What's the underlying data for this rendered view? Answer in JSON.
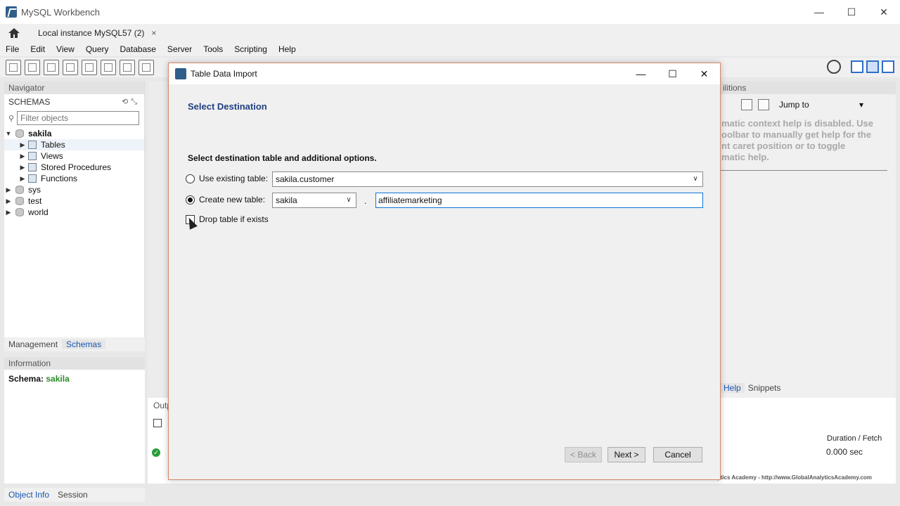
{
  "app": {
    "title": "MySQL Workbench",
    "window_controls": {
      "minimize": "—",
      "maximize": "☐",
      "close": "✕"
    }
  },
  "connection_tab": {
    "label": "Local instance MySQL57 (2)",
    "close": "×"
  },
  "menu": [
    "File",
    "Edit",
    "View",
    "Query",
    "Database",
    "Server",
    "Tools",
    "Scripting",
    "Help"
  ],
  "navigator": {
    "header": "Navigator",
    "schemas_label": "SCHEMAS",
    "filter_placeholder": "Filter objects",
    "tree": [
      {
        "label": "sakila",
        "expanded": true,
        "bold": true
      },
      {
        "label": "Tables"
      },
      {
        "label": "Views"
      },
      {
        "label": "Stored Procedures"
      },
      {
        "label": "Functions"
      },
      {
        "label": "sys"
      },
      {
        "label": "test"
      },
      {
        "label": "world"
      }
    ],
    "tabs": [
      "Management",
      "Schemas"
    ]
  },
  "information": {
    "header": "Information",
    "schema_label": "Schema:",
    "schema_value": "sakila"
  },
  "bottom_tabs": [
    "Object Info",
    "Session"
  ],
  "output": {
    "label": "Outp",
    "duration_header": "Duration / Fetch",
    "duration_value": "0.000 sec"
  },
  "right_panel": {
    "header": "ilitions",
    "jump_to": "Jump to",
    "help_lines": [
      "matic context help is disabled. Use",
      "oolbar to manually get help for the",
      "nt caret position or to toggle",
      "matic help."
    ],
    "tabs": [
      "Help",
      "Snippets"
    ]
  },
  "footer_brand": "Global Analytics Academy  - http://www.GlobalAnalyticsAcademy.com",
  "dialog": {
    "title": "Table Data Import",
    "heading": "Select Destination",
    "subheading": "Select destination table and additional options.",
    "use_existing": {
      "label": "Use existing table:",
      "value": "sakila.customer",
      "selected": false
    },
    "create_new": {
      "label": "Create new table:",
      "schema": "sakila",
      "separator": ".",
      "table_name": "affiliatemarketing",
      "selected": true
    },
    "drop_if_exists": {
      "label": "Drop table if exists",
      "checked": false
    },
    "buttons": {
      "back": "< Back",
      "next": "Next >",
      "cancel": "Cancel"
    }
  }
}
